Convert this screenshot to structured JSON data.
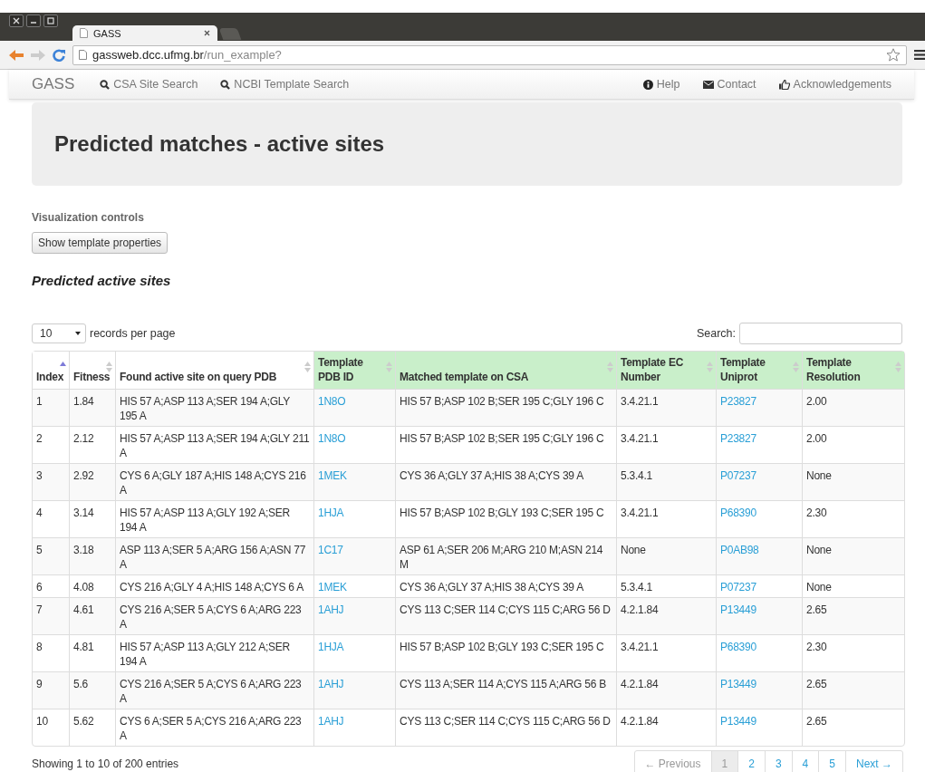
{
  "browser": {
    "tab_title": "GASS",
    "url_host": "gassweb.dcc.ufmg.br",
    "url_path": "/run_example?"
  },
  "navbar": {
    "brand": "GASS",
    "left_links": [
      {
        "label": "CSA Site Search"
      },
      {
        "label": "NCBI Template Search"
      }
    ],
    "right_links": [
      {
        "label": "Help"
      },
      {
        "label": "Contact"
      },
      {
        "label": "Acknowledgements"
      }
    ]
  },
  "heading": "Predicted matches - active sites",
  "controls": {
    "label": "Visualization controls",
    "button": "Show template properties"
  },
  "section_title": "Predicted active sites",
  "table": {
    "page_size": "10",
    "page_size_label": "records per page",
    "search_label": "Search:",
    "columns": [
      {
        "label": "Index",
        "sorted": true,
        "highlighted": false,
        "kind": "text"
      },
      {
        "label": "Fitness",
        "sorted": false,
        "highlighted": false,
        "kind": "text"
      },
      {
        "label": "Found active site on query PDB",
        "sorted": false,
        "highlighted": false,
        "kind": "text"
      },
      {
        "label": "Template PDB ID",
        "sorted": false,
        "highlighted": true,
        "kind": "link"
      },
      {
        "label": "Matched template on CSA",
        "sorted": false,
        "highlighted": true,
        "kind": "text"
      },
      {
        "label": "Template EC Number",
        "sorted": false,
        "highlighted": true,
        "kind": "text"
      },
      {
        "label": "Template Uniprot",
        "sorted": false,
        "highlighted": true,
        "kind": "link"
      },
      {
        "label": "Template Resolution",
        "sorted": false,
        "highlighted": true,
        "kind": "text"
      }
    ],
    "rows": [
      [
        "1",
        "1.84",
        "HIS 57 A;ASP 113 A;SER 194 A;GLY 195 A",
        "1N8O",
        "HIS 57 B;ASP 102 B;SER 195 C;GLY 196 C",
        "3.4.21.1",
        "P23827",
        "2.00"
      ],
      [
        "2",
        "2.12",
        "HIS 57 A;ASP 113 A;SER 194 A;GLY 211 A",
        "1N8O",
        "HIS 57 B;ASP 102 B;SER 195 C;GLY 196 C",
        "3.4.21.1",
        "P23827",
        "2.00"
      ],
      [
        "3",
        "2.92",
        "CYS 6 A;GLY 187 A;HIS 148 A;CYS 216 A",
        "1MEK",
        "CYS 36 A;GLY 37 A;HIS 38 A;CYS 39 A",
        "5.3.4.1",
        "P07237",
        "None"
      ],
      [
        "4",
        "3.14",
        "HIS 57 A;ASP 113 A;GLY 192 A;SER 194 A",
        "1HJA",
        "HIS 57 B;ASP 102 B;GLY 193 C;SER 195 C",
        "3.4.21.1",
        "P68390",
        "2.30"
      ],
      [
        "5",
        "3.18",
        "ASP 113 A;SER 5 A;ARG 156 A;ASN 77 A",
        "1C17",
        "ASP 61 A;SER 206 M;ARG 210 M;ASN 214 M",
        "None",
        "P0AB98",
        "None"
      ],
      [
        "6",
        "4.08",
        "CYS 216 A;GLY 4 A;HIS 148 A;CYS 6 A",
        "1MEK",
        "CYS 36 A;GLY 37 A;HIS 38 A;CYS 39 A",
        "5.3.4.1",
        "P07237",
        "None"
      ],
      [
        "7",
        "4.61",
        "CYS 216 A;SER 5 A;CYS 6 A;ARG 223 A",
        "1AHJ",
        "CYS 113 C;SER 114 C;CYS 115 C;ARG 56 D",
        "4.2.1.84",
        "P13449",
        "2.65"
      ],
      [
        "8",
        "4.81",
        "HIS 57 A;ASP 113 A;GLY 212 A;SER 194 A",
        "1HJA",
        "HIS 57 B;ASP 102 B;GLY 193 C;SER 195 C",
        "3.4.21.1",
        "P68390",
        "2.30"
      ],
      [
        "9",
        "5.6",
        "CYS 216 A;SER 5 A;CYS 6 A;ARG 223 A",
        "1AHJ",
        "CYS 113 A;SER 114 A;CYS 115 A;ARG 56 B",
        "4.2.1.84",
        "P13449",
        "2.65"
      ],
      [
        "10",
        "5.62",
        "CYS 6 A;SER 5 A;CYS 216 A;ARG 223 A",
        "1AHJ",
        "CYS 113 C;SER 114 C;CYS 115 C;ARG 56 D",
        "4.2.1.84",
        "P13449",
        "2.65"
      ]
    ],
    "info": "Showing 1 to 10 of 200 entries",
    "pagination": [
      {
        "label": "← Previous",
        "selected": false,
        "disabled": true
      },
      {
        "label": "1",
        "selected": true,
        "disabled": false
      },
      {
        "label": "2",
        "selected": false,
        "disabled": false
      },
      {
        "label": "3",
        "selected": false,
        "disabled": false
      },
      {
        "label": "4",
        "selected": false,
        "disabled": false
      },
      {
        "label": "5",
        "selected": false,
        "disabled": false
      },
      {
        "label": "Next →",
        "selected": false,
        "disabled": false
      }
    ]
  }
}
